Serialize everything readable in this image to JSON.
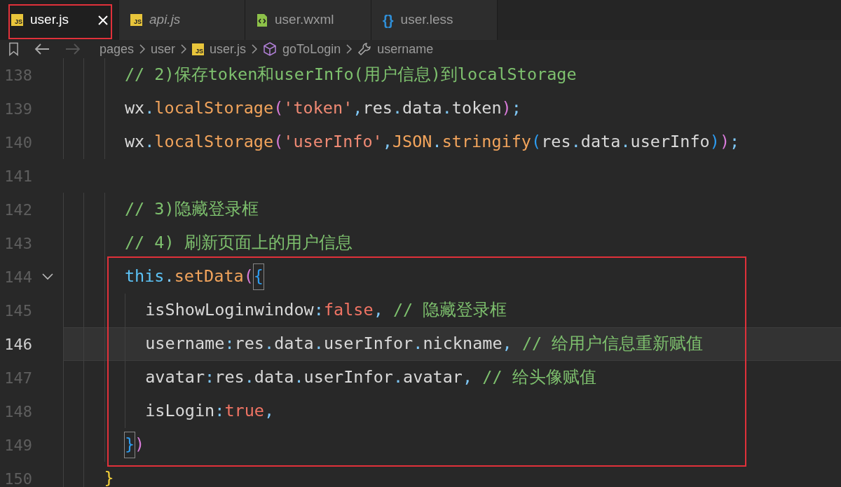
{
  "tabs": [
    {
      "label": "user.js",
      "kind": "js",
      "icon_label": "JS",
      "selected": true,
      "preview": false,
      "outlined": true
    },
    {
      "label": "api.js",
      "kind": "js",
      "icon_label": "JS",
      "selected": false,
      "preview": true,
      "outlined": false
    },
    {
      "label": "user.wxml",
      "kind": "wxml",
      "selected": false,
      "preview": false,
      "outlined": false
    },
    {
      "label": "user.less",
      "kind": "less",
      "icon_label": "{}",
      "selected": false,
      "preview": false,
      "outlined": false
    }
  ],
  "nav": [
    {
      "kind": "bookmark",
      "disabled": false
    },
    {
      "kind": "back",
      "disabled": false
    },
    {
      "kind": "forward",
      "disabled": true
    }
  ],
  "breadcrumb": [
    {
      "label": "pages",
      "kind": "folder"
    },
    {
      "label": "user",
      "kind": "folder"
    },
    {
      "label": "user.js",
      "kind": "file",
      "icon_label": "JS"
    },
    {
      "label": "goToLogin",
      "kind": "method"
    },
    {
      "label": "username",
      "kind": "property"
    }
  ],
  "lines": [
    {
      "number": "138",
      "current": false,
      "foldable": false,
      "boxed": false,
      "tokens": [
        {
          "kind": "comment",
          "text": "      // 2)保存token和userInfo(用户信息)到localStorage"
        }
      ]
    },
    {
      "number": "139",
      "current": false,
      "foldable": false,
      "boxed": false,
      "tokens": [
        {
          "kind": "plain",
          "text": "      wx"
        },
        {
          "kind": "punct",
          "text": "."
        },
        {
          "kind": "method",
          "text": "localStorage"
        },
        {
          "kind": "paren",
          "text": "("
        },
        {
          "kind": "string",
          "text": "'token'"
        },
        {
          "kind": "punct",
          "text": ","
        },
        {
          "kind": "plain",
          "text": "res"
        },
        {
          "kind": "punct",
          "text": "."
        },
        {
          "kind": "plain",
          "text": "data"
        },
        {
          "kind": "punct",
          "text": "."
        },
        {
          "kind": "plain",
          "text": "token"
        },
        {
          "kind": "paren",
          "text": ")"
        },
        {
          "kind": "punct",
          "text": ";"
        }
      ]
    },
    {
      "number": "140",
      "current": false,
      "foldable": false,
      "boxed": false,
      "tokens": [
        {
          "kind": "plain",
          "text": "      wx"
        },
        {
          "kind": "punct",
          "text": "."
        },
        {
          "kind": "method",
          "text": "localStorage"
        },
        {
          "kind": "paren",
          "text": "("
        },
        {
          "kind": "string",
          "text": "'userInfo'"
        },
        {
          "kind": "punct",
          "text": ","
        },
        {
          "kind": "method",
          "text": "JSON"
        },
        {
          "kind": "punct",
          "text": "."
        },
        {
          "kind": "method",
          "text": "stringify"
        },
        {
          "kind": "bracket",
          "text": "("
        },
        {
          "kind": "plain",
          "text": "res"
        },
        {
          "kind": "punct",
          "text": "."
        },
        {
          "kind": "plain",
          "text": "data"
        },
        {
          "kind": "punct",
          "text": "."
        },
        {
          "kind": "plain",
          "text": "userInfo"
        },
        {
          "kind": "bracket",
          "text": ")"
        },
        {
          "kind": "paren",
          "text": ")"
        },
        {
          "kind": "punct",
          "text": ";"
        }
      ]
    },
    {
      "number": "141",
      "current": false,
      "foldable": false,
      "boxed": false
    },
    {
      "number": "142",
      "current": false,
      "foldable": false,
      "boxed": false,
      "tokens": [
        {
          "kind": "comment",
          "text": "      // 3)隐藏登录框"
        }
      ]
    },
    {
      "number": "143",
      "current": false,
      "foldable": false,
      "boxed": false,
      "tokens": [
        {
          "kind": "comment",
          "text": "      // 4) 刷新页面上的用户信息"
        }
      ]
    },
    {
      "number": "144",
      "current": false,
      "foldable": true,
      "boxed": true,
      "tokens": [
        {
          "kind": "keyword",
          "text": "      this"
        },
        {
          "kind": "punct",
          "text": "."
        },
        {
          "kind": "method",
          "text": "setData"
        },
        {
          "kind": "paren",
          "text": "("
        },
        {
          "kind": "bracket",
          "text": "{",
          "matched": true
        }
      ]
    },
    {
      "number": "145",
      "current": false,
      "foldable": false,
      "boxed": true,
      "tokens": [
        {
          "kind": "plain",
          "text": "        isShowLoginwindow"
        },
        {
          "kind": "punct",
          "text": ":"
        },
        {
          "kind": "literal",
          "text": "false"
        },
        {
          "kind": "punct",
          "text": ","
        },
        {
          "kind": "comment",
          "text": " // 隐藏登录框"
        }
      ]
    },
    {
      "number": "146",
      "current": true,
      "foldable": false,
      "boxed": true,
      "tokens": [
        {
          "kind": "plain",
          "text": "        username"
        },
        {
          "kind": "punct",
          "text": ":"
        },
        {
          "kind": "plain",
          "text": "res"
        },
        {
          "kind": "punct",
          "text": "."
        },
        {
          "kind": "plain",
          "text": "data"
        },
        {
          "kind": "punct",
          "text": "."
        },
        {
          "kind": "plain",
          "text": "userInfor"
        },
        {
          "kind": "punct",
          "text": "."
        },
        {
          "kind": "plain",
          "text": "nickname"
        },
        {
          "kind": "punct",
          "text": ","
        },
        {
          "kind": "comment",
          "text": " // 给用户信息重新赋值"
        }
      ]
    },
    {
      "number": "147",
      "current": false,
      "foldable": false,
      "boxed": true,
      "tokens": [
        {
          "kind": "plain",
          "text": "        avatar"
        },
        {
          "kind": "punct",
          "text": ":"
        },
        {
          "kind": "plain",
          "text": "res"
        },
        {
          "kind": "punct",
          "text": "."
        },
        {
          "kind": "plain",
          "text": "data"
        },
        {
          "kind": "punct",
          "text": "."
        },
        {
          "kind": "plain",
          "text": "userInfor"
        },
        {
          "kind": "punct",
          "text": "."
        },
        {
          "kind": "plain",
          "text": "avatar"
        },
        {
          "kind": "punct",
          "text": ","
        },
        {
          "kind": "comment",
          "text": " // 给头像赋值"
        }
      ]
    },
    {
      "number": "148",
      "current": false,
      "foldable": false,
      "boxed": true,
      "tokens": [
        {
          "kind": "plain",
          "text": "        isLogin"
        },
        {
          "kind": "punct",
          "text": ":"
        },
        {
          "kind": "literal",
          "text": "true"
        },
        {
          "kind": "punct",
          "text": ","
        }
      ]
    },
    {
      "number": "149",
      "current": false,
      "foldable": false,
      "boxed": true,
      "tokens": [
        {
          "kind": "bracket",
          "text": "      }",
          "matched": true
        },
        {
          "kind": "paren",
          "text": ")"
        }
      ]
    },
    {
      "number": "150",
      "current": false,
      "foldable": false,
      "boxed": false,
      "tokens": [
        {
          "kind": "brace",
          "text": "    }"
        }
      ]
    }
  ]
}
